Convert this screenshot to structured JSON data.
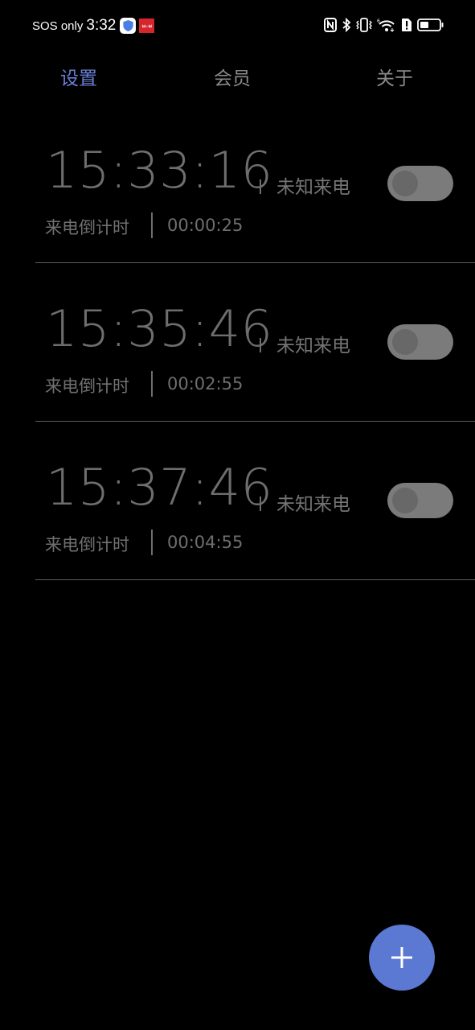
{
  "status_bar": {
    "sos_text": "SOS only",
    "time": "3:32",
    "left_icons": [
      "shield-app-icon",
      "red-app-icon"
    ],
    "red_app_text": "ㅂ·ㅂ",
    "right_icons": [
      "nfc-icon",
      "bluetooth-icon",
      "vibrate-icon",
      "wifi-icon",
      "sim-alert-icon",
      "battery-icon"
    ],
    "wifi_badge": "6",
    "battery_level_percent": 35
  },
  "tabs": [
    {
      "label": "设置",
      "active": true
    },
    {
      "label": "会员",
      "active": false
    },
    {
      "label": "关于",
      "active": false
    }
  ],
  "colors": {
    "accent": "#6a7fd6",
    "fab": "#5b78d3",
    "background": "#000000",
    "toggle_off": "#7b7b7b"
  },
  "items": [
    {
      "time": "15:33:16",
      "caller": "未知来电",
      "countdown_label": "来电倒计时",
      "countdown": "00:00:25",
      "enabled": false
    },
    {
      "time": "15:35:46",
      "caller": "未知来电",
      "countdown_label": "来电倒计时",
      "countdown": "00:02:55",
      "enabled": false
    },
    {
      "time": "15:37:46",
      "caller": "未知来电",
      "countdown_label": "来电倒计时",
      "countdown": "00:04:55",
      "enabled": false
    }
  ],
  "fab": {
    "icon": "plus-icon"
  }
}
